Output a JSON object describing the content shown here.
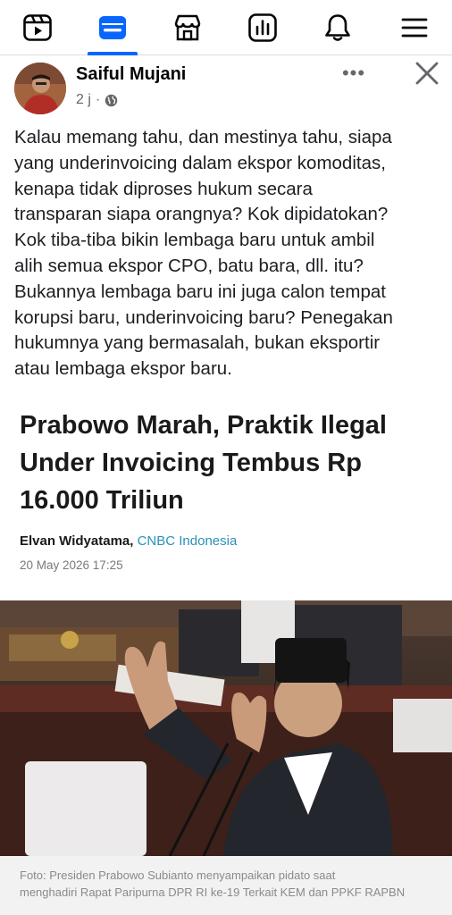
{
  "nav": {
    "items": [
      {
        "icon": "video-icon"
      },
      {
        "icon": "feed-icon",
        "active": true
      },
      {
        "icon": "marketplace-icon"
      },
      {
        "icon": "dashboard-icon"
      },
      {
        "icon": "bell-icon"
      },
      {
        "icon": "menu-icon"
      }
    ],
    "accent": "#0866ff"
  },
  "post": {
    "author": "Saiful Mujani",
    "time": "2 j",
    "more_label": "•••",
    "text_lines": [
      "Kalau memang tahu, dan mestinya tahu, siapa",
      "yang underinvoicing dalam ekspor komoditas,",
      "kenapa tidak diproses hukum secara",
      "transparan siapa orangnya? Kok dipidatokan?",
      "Kok tiba-tiba bikin lembaga baru untuk ambil",
      "alih semua ekspor CPO, batu bara, dll. itu?",
      "Bukannya lembaga baru ini juga calon tempat",
      "korupsi baru, underinvoicing baru? Penegakan",
      "hukumnya yang bermasalah, bukan eksportir",
      "atau lembaga ekspor baru."
    ]
  },
  "article": {
    "headline_lines": [
      "Prabowo Marah, Praktik Ilegal",
      "Under Invoicing Tembus Rp",
      "16.000 Triliun"
    ],
    "author": "Elvan Widyatama,",
    "outlet": "CNBC Indonesia",
    "date": "20 May 2026 17:25",
    "caption_lines": [
      "Foto: Presiden Prabowo Subianto menyampaikan pidato saat",
      "menghadiri Rapat Paripurna DPR RI ke-19 Terkait KEM dan PPKF RAPBN"
    ],
    "outlet_color": "#2a8fb8"
  }
}
